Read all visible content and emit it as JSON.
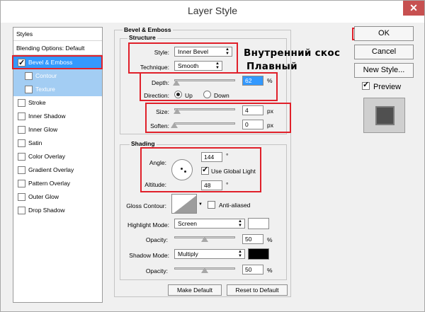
{
  "window": {
    "title": "Layer Style"
  },
  "styles": {
    "header": "Styles",
    "blending": "Blending Options: Default",
    "items": [
      {
        "label": "Bevel & Emboss",
        "checked": true,
        "state": "selected"
      },
      {
        "label": "Contour",
        "checked": false,
        "state": "sub"
      },
      {
        "label": "Texture",
        "checked": false,
        "state": "sub"
      },
      {
        "label": "Stroke",
        "checked": false
      },
      {
        "label": "Inner Shadow",
        "checked": false
      },
      {
        "label": "Inner Glow",
        "checked": false
      },
      {
        "label": "Satin",
        "checked": false
      },
      {
        "label": "Color Overlay",
        "checked": false
      },
      {
        "label": "Gradient Overlay",
        "checked": false
      },
      {
        "label": "Pattern Overlay",
        "checked": false
      },
      {
        "label": "Outer Glow",
        "checked": false
      },
      {
        "label": "Drop Shadow",
        "checked": false
      }
    ]
  },
  "bevel": {
    "section_title": "Bevel & Emboss",
    "structure": {
      "title": "Structure",
      "style_label": "Style:",
      "style_value": "Inner Bevel",
      "technique_label": "Technique:",
      "technique_value": "Smooth",
      "depth_label": "Depth:",
      "depth_value": "62",
      "depth_unit": "%",
      "direction_label": "Direction:",
      "direction_up": "Up",
      "direction_down": "Down",
      "size_label": "Size:",
      "size_value": "4",
      "size_unit": "px",
      "soften_label": "Soften:",
      "soften_value": "0",
      "soften_unit": "px"
    },
    "shading": {
      "title": "Shading",
      "angle_label": "Angle:",
      "angle_value": "144",
      "angle_unit": "°",
      "global_light_label": "Use Global Light",
      "altitude_label": "Altitude:",
      "altitude_value": "48",
      "altitude_unit": "°",
      "gloss_label": "Gloss Contour:",
      "anti_aliased_label": "Anti-aliased",
      "highlight_mode_label": "Highlight Mode:",
      "highlight_mode_value": "Screen",
      "highlight_color": "#ffffff",
      "opacity_label": "Opacity:",
      "highlight_opacity": "50",
      "shadow_mode_label": "Shadow Mode:",
      "shadow_mode_value": "Multiply",
      "shadow_color": "#000000",
      "shadow_opacity": "50",
      "opacity_unit": "%"
    },
    "make_default": "Make Default",
    "reset_default": "Reset to Default"
  },
  "annotations": {
    "inner_bevel": "Внутренний скос",
    "smooth": "Плавный"
  },
  "buttons": {
    "ok": "OK",
    "cancel": "Cancel",
    "new_style": "New Style...",
    "preview": "Preview"
  },
  "colors": {
    "accent_select": "#3399ff",
    "sub_select": "#a3cdf3",
    "annotation": "#e0202a"
  }
}
